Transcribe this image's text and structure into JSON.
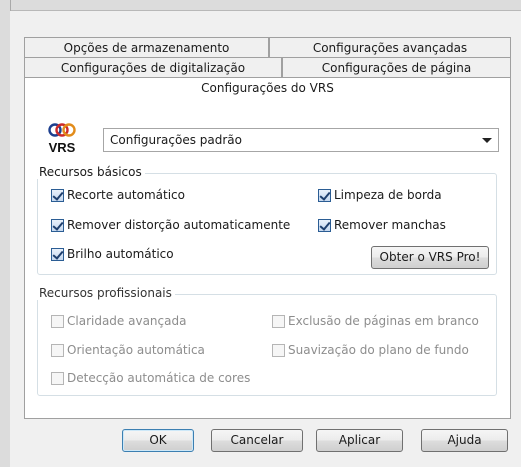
{
  "tabs_row1": [
    {
      "label": "Opções de armazenamento"
    },
    {
      "label": "Configurações avançadas"
    }
  ],
  "tabs_row2": [
    {
      "label": "Configurações de digitalização"
    },
    {
      "label": "Configurações de página"
    }
  ],
  "active_tab": {
    "label": "Configurações do VRS"
  },
  "vrs": {
    "logo_text": "VRS",
    "preset_selected": "Configurações padrão"
  },
  "basic": {
    "legend": "Recursos básicos",
    "items": [
      {
        "label": "Recorte automático",
        "checked": true
      },
      {
        "label": "Limpeza de borda",
        "checked": true
      },
      {
        "label": "Remover distorção automaticamente",
        "checked": true
      },
      {
        "label": "Remover manchas",
        "checked": true
      },
      {
        "label": "Brilho automático",
        "checked": true
      }
    ],
    "pro_button": "Obter o VRS Pro!"
  },
  "pro": {
    "legend": "Recursos profissionais",
    "items": [
      {
        "label": "Claridade avançada",
        "checked": false
      },
      {
        "label": "Exclusão de páginas em branco",
        "checked": false
      },
      {
        "label": "Orientação automática",
        "checked": false
      },
      {
        "label": "Suavização do plano de fundo",
        "checked": false
      },
      {
        "label": "Detecção automática de cores",
        "checked": false
      }
    ]
  },
  "buttons": {
    "ok": "OK",
    "cancel": "Cancelar",
    "apply": "Aplicar",
    "help": "Ajuda"
  }
}
